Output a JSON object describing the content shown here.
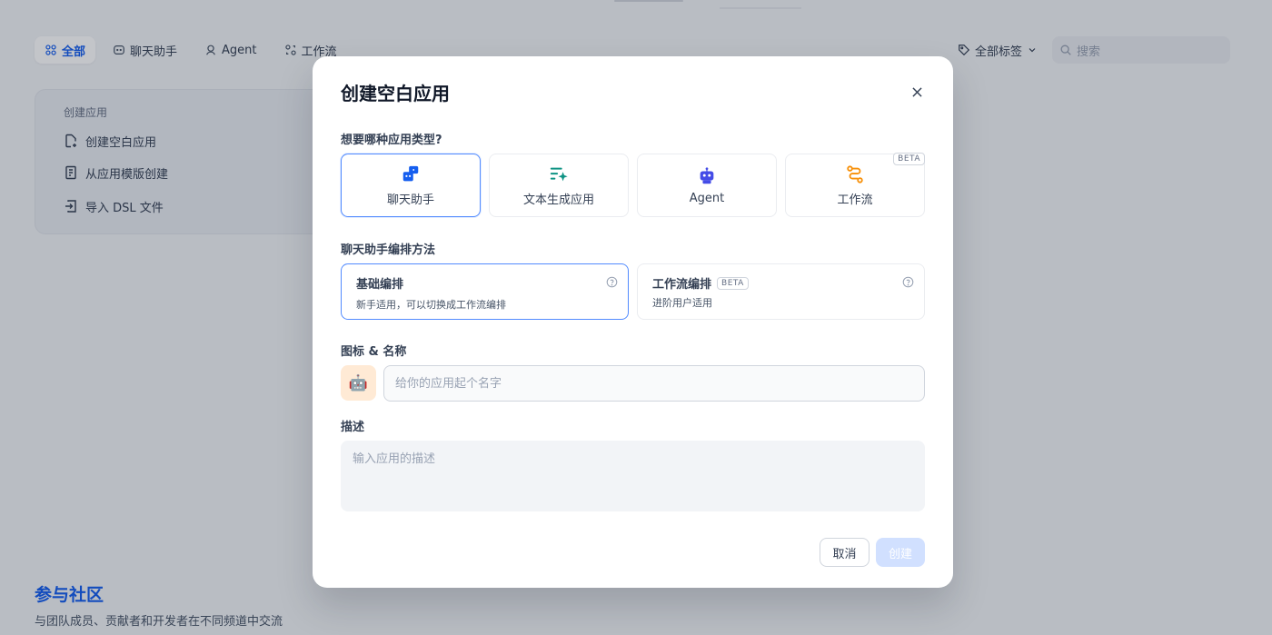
{
  "background": {
    "tabs": [
      {
        "label": "全部",
        "icon": "grid-icon",
        "active": true
      },
      {
        "label": "聊天助手",
        "icon": "chat-icon",
        "active": false
      },
      {
        "label": "Agent",
        "icon": "agent-icon",
        "active": false
      },
      {
        "label": "工作流",
        "icon": "workflow-icon",
        "active": false
      }
    ],
    "tags_dropdown": "全部标签",
    "search_placeholder": "搜索",
    "create_card": {
      "title": "创建应用",
      "items": [
        "创建空白应用",
        "从应用模版创建",
        "导入 DSL 文件"
      ]
    },
    "community": {
      "title": "参与社区",
      "subtitle": "与团队成员、贡献者和开发者在不同频道中交流"
    }
  },
  "modal": {
    "title": "创建空白应用",
    "type_question": "想要哪种应用类型?",
    "app_types": [
      {
        "label": "聊天助手",
        "icon": "chat-bot-icon",
        "color": "#155eef",
        "selected": true,
        "beta": ""
      },
      {
        "label": "文本生成应用",
        "icon": "text-generation-icon",
        "color": "#0e9384",
        "selected": false,
        "beta": ""
      },
      {
        "label": "Agent",
        "icon": "robot-icon",
        "color": "#444ce7",
        "selected": false,
        "beta": ""
      },
      {
        "label": "工作流",
        "icon": "workflow-route-icon",
        "color": "#f79009",
        "selected": false,
        "beta": "BETA"
      }
    ],
    "orchestration_label": "聊天助手编排方法",
    "modes": [
      {
        "title": "基础编排",
        "desc": "新手适用，可以切换成工作流编排",
        "selected": true,
        "beta": ""
      },
      {
        "title": "工作流编排",
        "desc": "进阶用户适用",
        "selected": false,
        "beta": "BETA"
      }
    ],
    "icon_name_label": "图标 & 名称",
    "emoji": "🤖",
    "name_placeholder": "给你的应用起个名字",
    "desc_label": "描述",
    "desc_placeholder": "输入应用的描述",
    "cancel_label": "取消",
    "create_label": "创建"
  },
  "colors": {
    "accent": "#155eef",
    "selected_border": "#528bff",
    "create_disabled": "#d1e0ff"
  }
}
